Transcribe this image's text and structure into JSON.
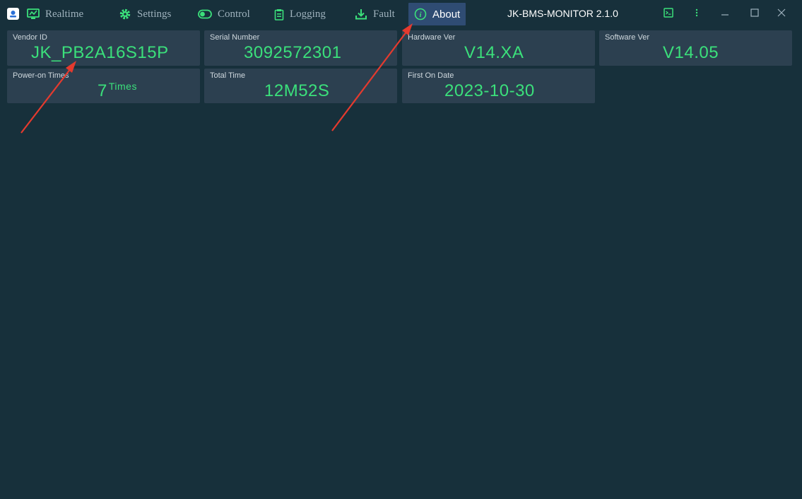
{
  "window": {
    "title": "JK-BMS-MONITOR 2.1.0"
  },
  "nav": {
    "items": [
      {
        "label": "Realtime",
        "icon": "monitor-icon"
      },
      {
        "label": "Settings",
        "icon": "gear-icon"
      },
      {
        "label": "Control",
        "icon": "toggle-icon"
      },
      {
        "label": "Logging",
        "icon": "clipboard-icon"
      },
      {
        "label": "Fault",
        "icon": "download-icon"
      },
      {
        "label": "About",
        "icon": "info-icon",
        "active": true
      }
    ]
  },
  "info": {
    "vendor_id": {
      "label": "Vendor ID",
      "value": "JK_PB2A16S15P"
    },
    "serial_number": {
      "label": "Serial Number",
      "value": "3092572301"
    },
    "hardware_ver": {
      "label": "Hardware Ver",
      "value": "V14.XA"
    },
    "software_ver": {
      "label": "Software Ver",
      "value": "V14.05"
    },
    "power_on_times": {
      "label": "Power-on Times",
      "value": "7",
      "unit": "Times"
    },
    "total_time": {
      "label": "Total Time",
      "value": "12M52S"
    },
    "first_on_date": {
      "label": "First On Date",
      "value": "2023-10-30"
    }
  },
  "colors": {
    "background": "#17303b",
    "card": "#2c4050",
    "value_green": "#3be07b",
    "active_tab": "#2f4c73",
    "annotation_arrow": "#e53a2e"
  }
}
